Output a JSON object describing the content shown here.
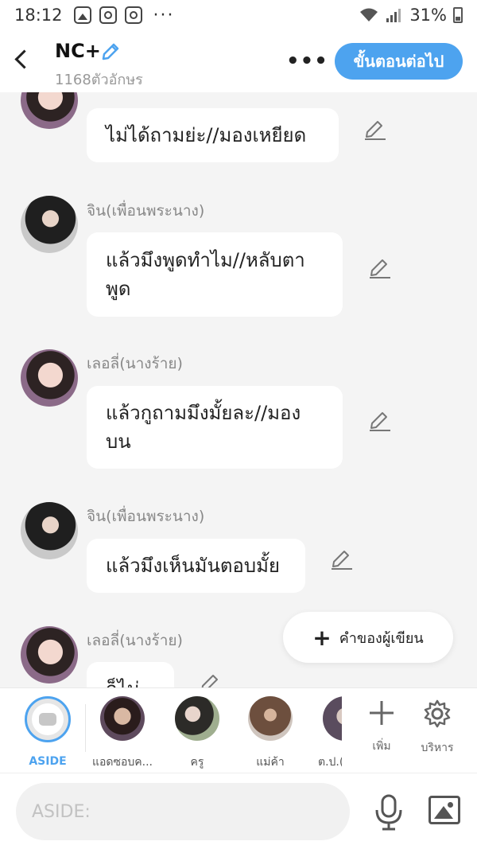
{
  "status_bar": {
    "time": "18:12",
    "more": "···",
    "battery_pct": "31%"
  },
  "header": {
    "title": "NC+",
    "char_count": "1168ตัวอักษร",
    "more": "•••",
    "next_label": "ขั้นตอนต่อไป"
  },
  "messages": [
    {
      "sender": "",
      "text": "ไม่ได้ถามย่ะ//มองเหยียด"
    },
    {
      "sender": "จิน(เพื่อนพระนาง)",
      "text": "แล้วมึงพูดทำไม//หลับตาพูด"
    },
    {
      "sender": "เลอลี่(นางร้าย)",
      "text": "แล้วกูถามมึงมั้ยละ//มองบน"
    },
    {
      "sender": "จิน(เพื่อนพระนาง)",
      "text": "แล้วมึงเห็นมันตอบมั้ย"
    },
    {
      "sender": "เลอลี่(นางร้าย)",
      "text": "ก็ไม่เห็น"
    }
  ],
  "fab": {
    "label": "คำของผู้เขียน"
  },
  "characters": [
    {
      "name": "ASIDE"
    },
    {
      "name": "แอดซอบค..."
    },
    {
      "name": "ครู"
    },
    {
      "name": "แม่ค้า"
    },
    {
      "name": "ต.ป.("
    }
  ],
  "tools": {
    "add_label": "เพิ่ม",
    "manage_label": "บริหาร"
  },
  "input": {
    "placeholder": "ASIDE:"
  },
  "colors": {
    "accent": "#4da3ef"
  }
}
